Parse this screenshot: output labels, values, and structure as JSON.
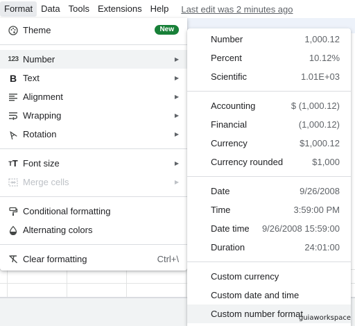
{
  "menubar": {
    "items": [
      "Format",
      "Data",
      "Tools",
      "Extensions",
      "Help"
    ],
    "last_edit": "Last edit was 2 minutes ago"
  },
  "format_menu": {
    "theme": {
      "label": "Theme",
      "badge": "New"
    },
    "number": {
      "label": "Number"
    },
    "text": {
      "label": "Text"
    },
    "alignment": {
      "label": "Alignment"
    },
    "wrapping": {
      "label": "Wrapping"
    },
    "rotation": {
      "label": "Rotation"
    },
    "font_size": {
      "label": "Font size"
    },
    "merge_cells": {
      "label": "Merge cells"
    },
    "conditional_formatting": {
      "label": "Conditional formatting"
    },
    "alternating_colors": {
      "label": "Alternating colors"
    },
    "clear_formatting": {
      "label": "Clear formatting",
      "shortcut": "Ctrl+\\"
    }
  },
  "number_submenu": {
    "number": {
      "label": "Number",
      "value": "1,000.12"
    },
    "percent": {
      "label": "Percent",
      "value": "10.12%"
    },
    "scientific": {
      "label": "Scientific",
      "value": "1.01E+03"
    },
    "accounting": {
      "label": "Accounting",
      "value": "$ (1,000.12)"
    },
    "financial": {
      "label": "Financial",
      "value": "(1,000.12)"
    },
    "currency": {
      "label": "Currency",
      "value": "$1,000.12"
    },
    "currency_rounded": {
      "label": "Currency rounded",
      "value": "$1,000"
    },
    "date": {
      "label": "Date",
      "value": "9/26/2008"
    },
    "time": {
      "label": "Time",
      "value": "3:59:00 PM"
    },
    "date_time": {
      "label": "Date time",
      "value": "9/26/2008 15:59:00"
    },
    "duration": {
      "label": "Duration",
      "value": "24:01:00"
    },
    "custom_currency": {
      "label": "Custom currency"
    },
    "custom_date_time": {
      "label": "Custom date and time"
    },
    "custom_number_format": {
      "label": "Custom number format"
    }
  },
  "watermark": "guiaworkspace",
  "colors": {
    "hover": "#f1f3f4",
    "badge_green": "#188038",
    "separator": "#dadce0",
    "disabled": "#bdc1c6"
  }
}
